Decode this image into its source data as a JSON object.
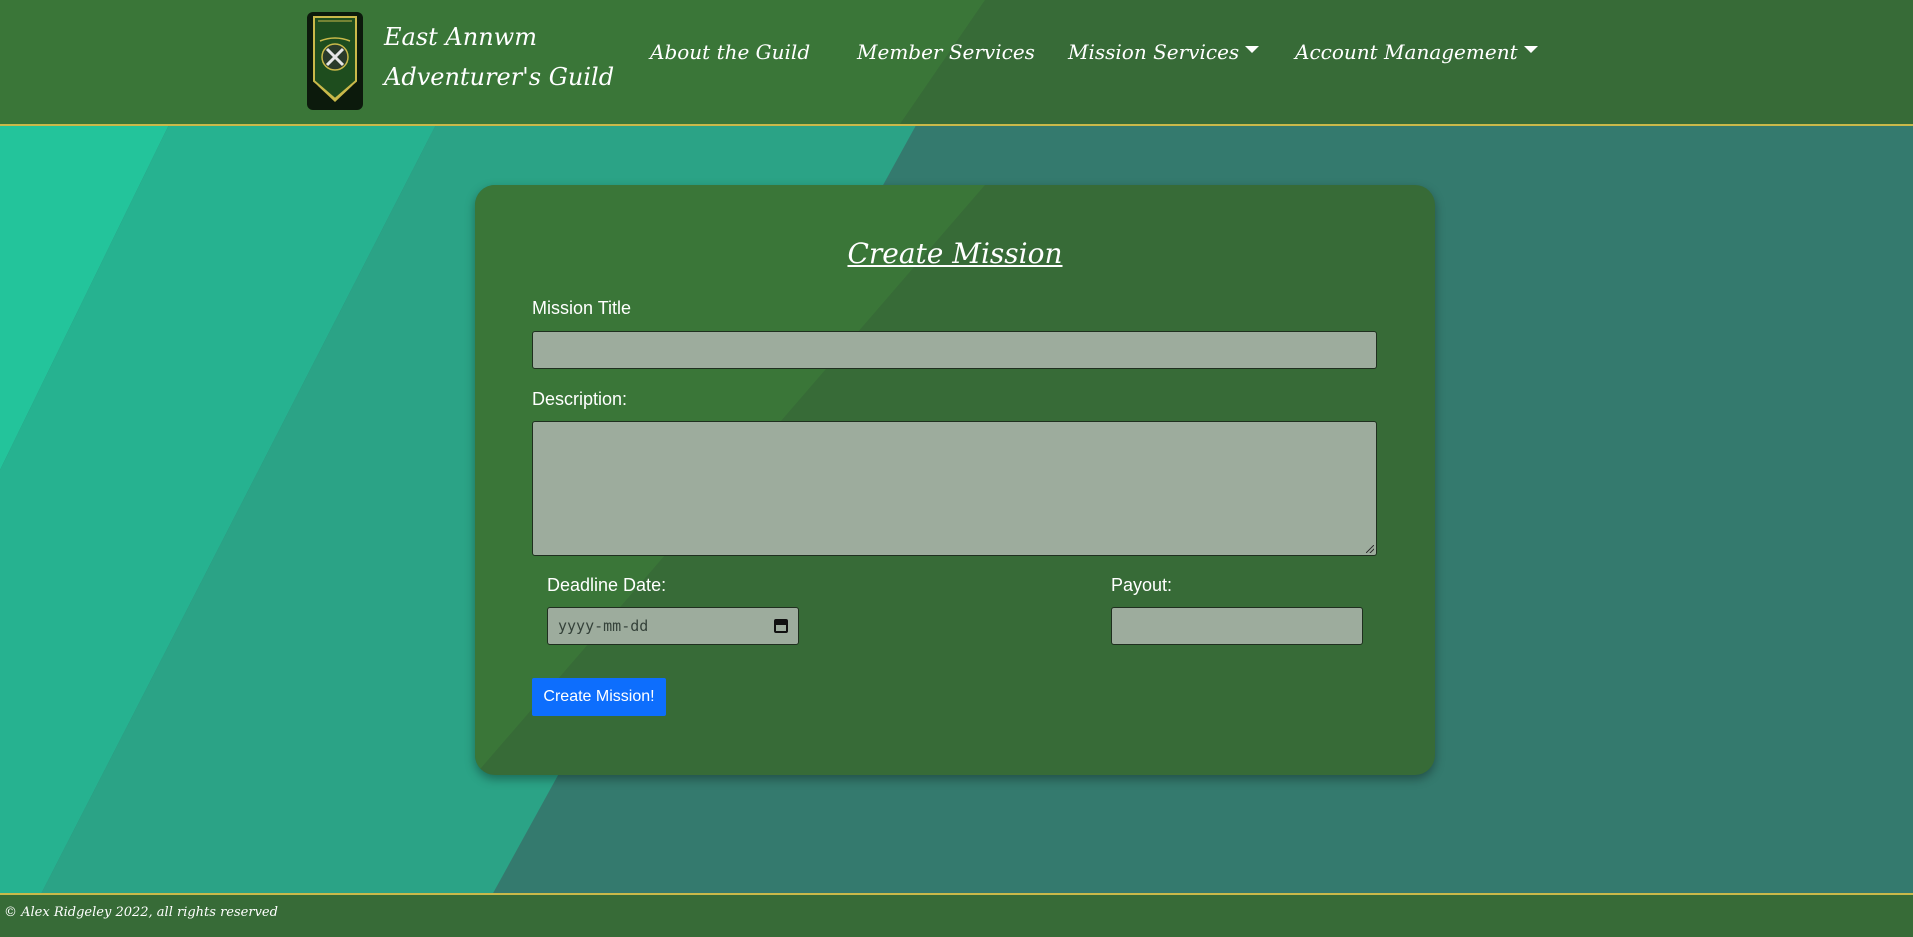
{
  "brand": {
    "line1": "East Annwm",
    "line2": "Adventurer's Guild",
    "logo_icon": "guild-banner-icon"
  },
  "nav": {
    "items": [
      {
        "label": "About the Guild",
        "has_dropdown": false
      },
      {
        "label": "Member Services",
        "has_dropdown": false
      },
      {
        "label": "Mission Services",
        "has_dropdown": true
      },
      {
        "label": "Account Management",
        "has_dropdown": true
      }
    ]
  },
  "form": {
    "title": "Create Mission",
    "mission_title_label": "Mission Title",
    "mission_title_value": "",
    "description_label": "Description:",
    "description_value": "",
    "deadline_label": "Deadline Date:",
    "deadline_placeholder": "yyyy-mm-dd",
    "payout_label": "Payout:",
    "payout_value": "",
    "submit_label": "Create Mission!"
  },
  "footer": {
    "text": "© Alex Ridgeley 2022, all rights reserved"
  },
  "colors": {
    "bar_green": "#376b37",
    "gold_border": "#c9b94a",
    "field_bg": "#9dac9d",
    "button_blue": "#0d6efd",
    "bg_teal": "#347a6e",
    "bg_light_teal": "#23c49b"
  }
}
